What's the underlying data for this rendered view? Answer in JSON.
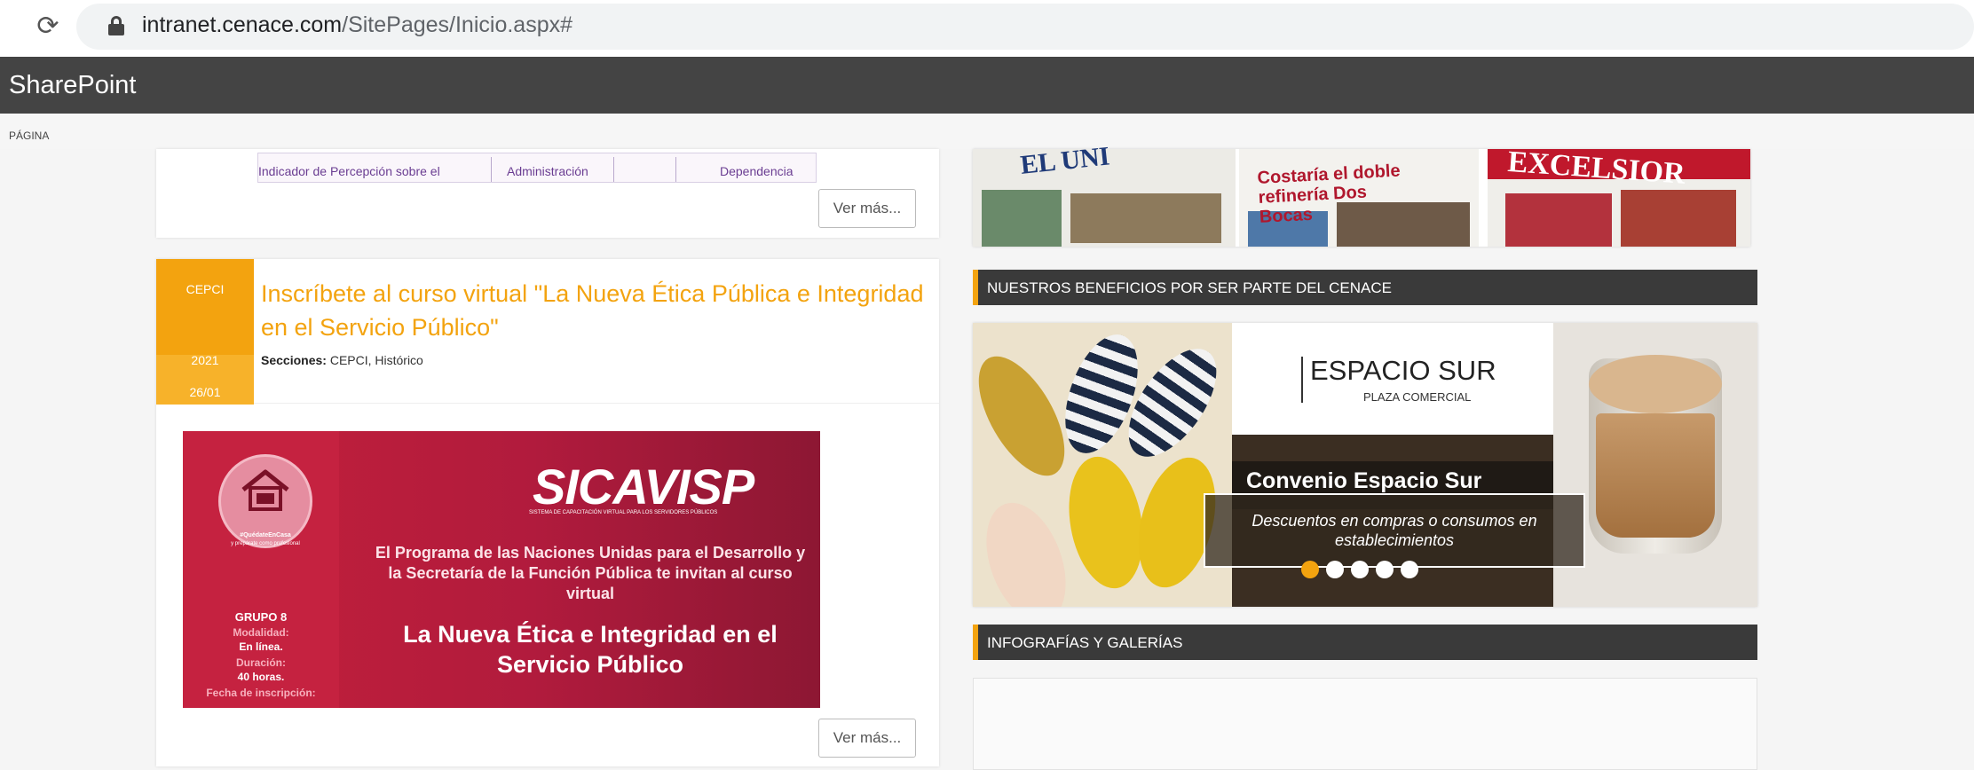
{
  "browser": {
    "reload_icon": "reload-icon",
    "lock_icon": "lock-icon",
    "url_host": "intranet.cenace.com",
    "url_path": "/SitePages/Inicio.aspx#"
  },
  "suite_bar": {
    "title": "SharePoint"
  },
  "ribbon": {
    "tab": "PÁGINA"
  },
  "left_column": {
    "table_snippet": {
      "cells": [
        "Indicador de Percepción sobre el",
        "Administración",
        "Dependencia"
      ]
    },
    "ver_mas_1": "Ver más...",
    "news": {
      "badge_label": "CEPCI",
      "badge_year": "2021",
      "badge_date": "26/01",
      "title": "Inscríbete al curso virtual \"La Nueva Ética Pública e Integridad en el Servicio Público\"",
      "sections_label": "Secciones:",
      "sections_value": " CEPCI, Histórico"
    },
    "banner": {
      "circle_caption": "#QuédateEnCasa",
      "circle_caption2": "y prepárate como profesional",
      "grupo": "GRUPO 8",
      "modalidad_label": "Modalidad:",
      "modalidad_value": "En línea.",
      "duracion_label": "Duración:",
      "duracion_value": "40 horas.",
      "fecha_label": "Fecha de inscripción:",
      "logo": "SICAVISP",
      "logo_sub": "SISTEMA DE CAPACITACIÓN VIRTUAL PARA LOS SERVIDORES PÚBLICOS",
      "program_text": "El Programa de las Naciones Unidas para el Desarrollo y la Secretaría de la Función Pública te invitan al curso virtual",
      "course_title": "La Nueva Ética e Integridad en el Servicio Público"
    },
    "ver_mas_2": "Ver más..."
  },
  "right_column": {
    "newspapers": {
      "paper1": "EL UNI",
      "paper2": "Costaría el doble refinería Dos Bocas",
      "paper3": "EXCELSIOR"
    },
    "beneficios_header": "NUESTROS BENEFICIOS POR SER PARTE DEL CENACE",
    "promo": {
      "store_name": "ESPACIO SUR",
      "store_sub": "PLAZA COMERCIAL",
      "title": "Convenio Espacio Sur",
      "description": "Descuentos en compras o consumos en establecimientos",
      "slide_count": 5,
      "active_slide": 1
    },
    "infografias_header": "INFOGRAFÍAS Y GALERÍAS"
  },
  "colors": {
    "accent": "#f3a30f",
    "suite_bar": "#444444",
    "section_header": "#3a3a3a"
  }
}
